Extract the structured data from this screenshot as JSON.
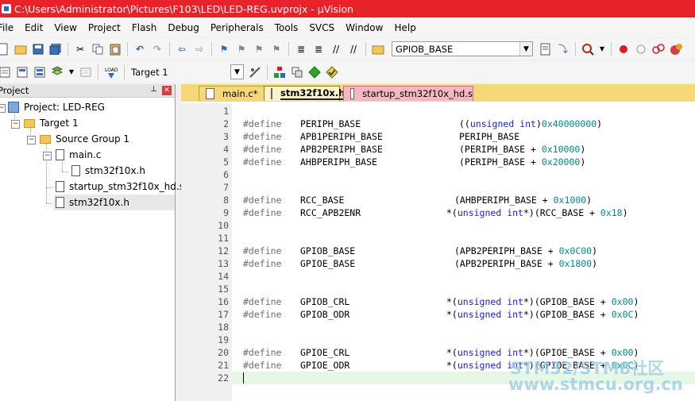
{
  "window": {
    "title": "C:\\Users\\Administrator\\Pictures\\F103\\LED\\LED-REG.uvprojx - µVision"
  },
  "menu": [
    "File",
    "Edit",
    "View",
    "Project",
    "Flash",
    "Debug",
    "Peripherals",
    "Tools",
    "SVCS",
    "Window",
    "Help"
  ],
  "toolbar": {
    "find_combo_value": "GPIOB_BASE",
    "target_combo_value": "Target 1"
  },
  "project_panel": {
    "title": "Project",
    "tree": [
      {
        "label": "Project: LED-REG"
      },
      {
        "label": "Target 1"
      },
      {
        "label": "Source Group 1"
      },
      {
        "label": "main.c"
      },
      {
        "label": "stm32f10x.h"
      },
      {
        "label": "startup_stm32f10x_hd.s"
      },
      {
        "label": "stm32f10x.h"
      }
    ]
  },
  "tabs": [
    {
      "label": "main.c*"
    },
    {
      "label": "stm32f10x.h"
    },
    {
      "label": "startup_stm32f10x_hd.s"
    }
  ],
  "code_lines": [
    {
      "n": "1",
      "dir": "",
      "name": "",
      "val": ""
    },
    {
      "n": "2",
      "dir": "#define",
      "name": "PERIPH_BASE",
      "val": "((unsigned int)0x40000000)"
    },
    {
      "n": "3",
      "dir": "#define",
      "name": "APB1PERIPH_BASE",
      "val": "PERIPH_BASE"
    },
    {
      "n": "4",
      "dir": "#define",
      "name": "APB2PERIPH_BASE",
      "val": "(PERIPH_BASE + 0x10000)"
    },
    {
      "n": "5",
      "dir": "#define",
      "name": "AHBPERIPH_BASE",
      "val": "(PERIPH_BASE + 0x20000)"
    },
    {
      "n": "6",
      "dir": "",
      "name": "",
      "val": ""
    },
    {
      "n": "7",
      "dir": "",
      "name": "",
      "val": ""
    },
    {
      "n": "8",
      "dir": "#define",
      "name": "RCC_BASE",
      "val": "(AHBPERIPH_BASE + 0x1000)"
    },
    {
      "n": "9",
      "dir": "#define",
      "name": "RCC_APB2ENR",
      "val": "*(unsigned int*)(RCC_BASE + 0x18)"
    },
    {
      "n": "10",
      "dir": "",
      "name": "",
      "val": ""
    },
    {
      "n": "11",
      "dir": "",
      "name": "",
      "val": ""
    },
    {
      "n": "12",
      "dir": "#define",
      "name": "GPIOB_BASE",
      "val": "(APB2PERIPH_BASE + 0x0C00)"
    },
    {
      "n": "13",
      "dir": "#define",
      "name": "GPIOE_BASE",
      "val": "(APB2PERIPH_BASE + 0x1800)"
    },
    {
      "n": "14",
      "dir": "",
      "name": "",
      "val": ""
    },
    {
      "n": "15",
      "dir": "",
      "name": "",
      "val": ""
    },
    {
      "n": "16",
      "dir": "#define",
      "name": "GPIOB_CRL",
      "val": "*(unsigned int*)(GPIOB_BASE + 0x00)"
    },
    {
      "n": "17",
      "dir": "#define",
      "name": "GPIOB_ODR",
      "val": "*(unsigned int*)(GPIOB_BASE + 0x0C)"
    },
    {
      "n": "18",
      "dir": "",
      "name": "",
      "val": ""
    },
    {
      "n": "19",
      "dir": "",
      "name": "",
      "val": ""
    },
    {
      "n": "20",
      "dir": "#define",
      "name": "GPIOE_CRL",
      "val": "*(unsigned int*)(GPIOE_BASE + 0x00)"
    },
    {
      "n": "21",
      "dir": "#define",
      "name": "GPIOE_ODR",
      "val": "*(unsigned int*)(GPIOE_BASE + 0x0C)"
    },
    {
      "n": "22",
      "dir": "",
      "name": "",
      "val": ""
    }
  ],
  "watermark": {
    "line1": "STM32/STM8社区",
    "line2": "www.stmcu.org.cn"
  },
  "colors": {
    "titlebar": "#e8222b",
    "keyword": "#1a1ae6",
    "number": "#008a8a",
    "tab_bar": "#f6d87a"
  }
}
